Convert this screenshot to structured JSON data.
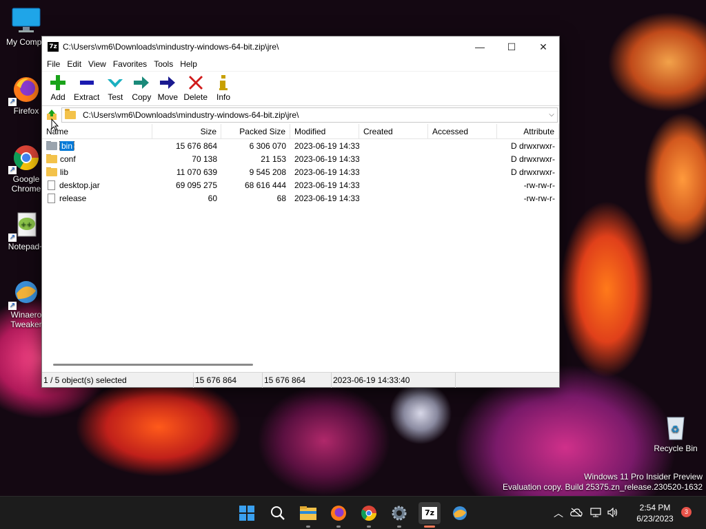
{
  "desktop": {
    "icons": [
      {
        "label": "My Compu",
        "icon": "monitor-icon"
      },
      {
        "label": "Firefox",
        "icon": "firefox-icon"
      },
      {
        "label": "Google Chrome",
        "icon": "chrome-icon"
      },
      {
        "label": "Notepad+",
        "icon": "notepad-plus-plus-icon"
      },
      {
        "label": "Winaero Tweaker",
        "icon": "winaero-tweaker-icon"
      },
      {
        "label": "Recycle Bin",
        "icon": "recycle-bin-icon"
      }
    ]
  },
  "window": {
    "app_icon_text": "7z",
    "title": "C:\\Users\\vm6\\Downloads\\mindustry-windows-64-bit.zip\\jre\\",
    "controls": {
      "minimize": "—",
      "maximize": "☐",
      "close": "✕"
    },
    "menu": [
      "File",
      "Edit",
      "View",
      "Favorites",
      "Tools",
      "Help"
    ],
    "toolbar": [
      {
        "label": "Add",
        "icon": "add-icon",
        "color": "#1aa31a"
      },
      {
        "label": "Extract",
        "icon": "extract-icon",
        "color": "#1a1ab0"
      },
      {
        "label": "Test",
        "icon": "test-icon",
        "color": "#1ab0c0"
      },
      {
        "label": "Copy",
        "icon": "copy-icon",
        "color": "#1a8a7a"
      },
      {
        "label": "Move",
        "icon": "move-icon",
        "color": "#1a1a90"
      },
      {
        "label": "Delete",
        "icon": "delete-icon",
        "color": "#d01a1a"
      },
      {
        "label": "Info",
        "icon": "info-icon",
        "color": "#c8a000"
      }
    ],
    "address": "C:\\Users\\vm6\\Downloads\\mindustry-windows-64-bit.zip\\jre\\",
    "columns": [
      "Name",
      "Size",
      "Packed Size",
      "Modified",
      "Created",
      "Accessed",
      "Attribute"
    ],
    "rows": [
      {
        "name": "bin",
        "type": "folder",
        "size": "15 676 864",
        "packed": "6 306 070",
        "modified": "2023-06-19 14:33",
        "created": "",
        "accessed": "",
        "attr": "D drwxrwxr-",
        "selected": true
      },
      {
        "name": "conf",
        "type": "folder",
        "size": "70 138",
        "packed": "21 153",
        "modified": "2023-06-19 14:33",
        "created": "",
        "accessed": "",
        "attr": "D drwxrwxr-",
        "selected": false
      },
      {
        "name": "lib",
        "type": "folder",
        "size": "11 070 639",
        "packed": "9 545 208",
        "modified": "2023-06-19 14:33",
        "created": "",
        "accessed": "",
        "attr": "D drwxrwxr-",
        "selected": false
      },
      {
        "name": "desktop.jar",
        "type": "file",
        "size": "69 095 275",
        "packed": "68 616 444",
        "modified": "2023-06-19 14:33",
        "created": "",
        "accessed": "",
        "attr": "-rw-rw-r-",
        "selected": false
      },
      {
        "name": "release",
        "type": "file",
        "size": "60",
        "packed": "68",
        "modified": "2023-06-19 14:33",
        "created": "",
        "accessed": "",
        "attr": "-rw-rw-r-",
        "selected": false
      }
    ],
    "status": {
      "selection": "1 / 5 object(s) selected",
      "size": "15 676 864",
      "packed": "15 676 864",
      "modified": "2023-06-19 14:33:40"
    }
  },
  "watermark": {
    "line1": "Windows 11 Pro Insider Preview",
    "line2": "Evaluation copy. Build 25375.zn_release.230520-1632"
  },
  "taskbar": {
    "apps": [
      "windows-start-icon",
      "search-icon",
      "file-explorer-icon",
      "firefox-icon",
      "chrome-icon",
      "settings-icon",
      "7zip-icon",
      "winaero-tweaker-icon"
    ],
    "time": "2:54 PM",
    "date": "6/23/2023",
    "notification_count": "3"
  }
}
